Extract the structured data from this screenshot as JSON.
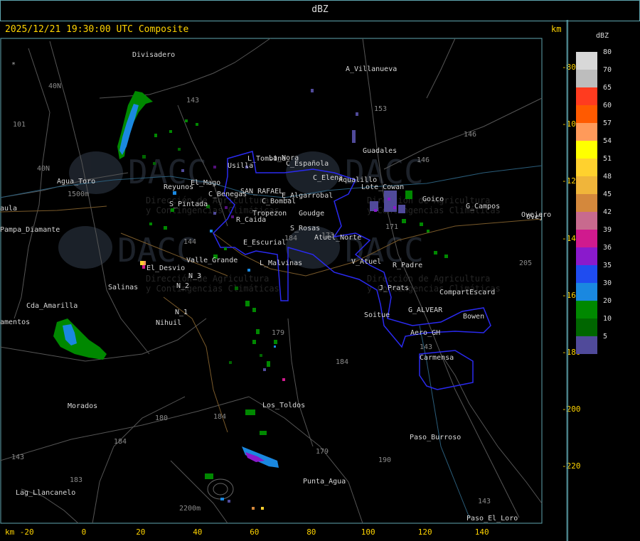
{
  "window": {
    "title": "dBZ"
  },
  "header": {
    "timestamp_label": "2025/12/21 19:30:00 UTC Composite",
    "km_unit": "km"
  },
  "axes": {
    "unit": "km",
    "y_ticks": [
      "-80",
      "-100",
      "-120",
      "-140",
      "-160",
      "-180",
      "-200",
      "-220"
    ],
    "x_ticks": [
      "-20",
      "0",
      "20",
      "40",
      "60",
      "80",
      "100",
      "120",
      "140"
    ]
  },
  "legend": {
    "title": "dBZ",
    "entries": [
      {
        "label": "80",
        "color": "#d8d8d8"
      },
      {
        "label": "70",
        "color": "#bdbdbd"
      },
      {
        "label": "65",
        "color": "#ff3b1f"
      },
      {
        "label": "60",
        "color": "#ff5a00"
      },
      {
        "label": "57",
        "color": "#ff9a5a"
      },
      {
        "label": "54",
        "color": "#ffff00"
      },
      {
        "label": "51",
        "color": "#ffd12e"
      },
      {
        "label": "48",
        "color": "#f0b53a"
      },
      {
        "label": "45",
        "color": "#d4883c"
      },
      {
        "label": "42",
        "color": "#c86a8e"
      },
      {
        "label": "39",
        "color": "#d01a8e"
      },
      {
        "label": "36",
        "color": "#8a1acc"
      },
      {
        "label": "35",
        "color": "#1f4cf0"
      },
      {
        "label": "30",
        "color": "#1a88e0"
      },
      {
        "label": "20",
        "color": "#008800"
      },
      {
        "label": "10",
        "color": "#006600"
      },
      {
        "label": "5",
        "color": "#504a9a"
      }
    ]
  },
  "watermark": {
    "brand": "DACC",
    "line1": "Dirección de Agricultura",
    "line2": "y Contingencias Climáticas"
  },
  "places": [
    {
      "name": "Divisadero"
    },
    {
      "name": "A_Villanueva"
    },
    {
      "name": "L_Tombina"
    },
    {
      "name": "Usilla"
    },
    {
      "name": "La_Nora"
    },
    {
      "name": "C_Española"
    },
    {
      "name": "C_Elena"
    },
    {
      "name": "Guadales"
    },
    {
      "name": "Aqualillo"
    },
    {
      "name": "Lote_Cowan"
    },
    {
      "name": "Goico"
    },
    {
      "name": "G_Campos"
    },
    {
      "name": "Ovejero"
    },
    {
      "name": "Agua_Toro"
    },
    {
      "name": "Reyunos"
    },
    {
      "name": "El_Mago"
    },
    {
      "name": "C_Benegas"
    },
    {
      "name": "SAN_RAFAEL"
    },
    {
      "name": "E_Algarrobal"
    },
    {
      "name": "C_Bombal"
    },
    {
      "name": "S_Pintada"
    },
    {
      "name": "Tropezon"
    },
    {
      "name": "Goudge"
    },
    {
      "name": "R_Caida"
    },
    {
      "name": "S_Rosas"
    },
    {
      "name": "Atuel_Norte"
    },
    {
      "name": "Pampa_Diamante"
    },
    {
      "name": "E_Escurial"
    },
    {
      "name": "V_Atuel"
    },
    {
      "name": "R_Padre"
    },
    {
      "name": "El_Desvio"
    },
    {
      "name": "Valle_Grande"
    },
    {
      "name": "L_Malvinas"
    },
    {
      "name": "Salinas"
    },
    {
      "name": "N_2"
    },
    {
      "name": "N_3"
    },
    {
      "name": "J_Prats"
    },
    {
      "name": "CompartEscard"
    },
    {
      "name": "Cda_Amarilla"
    },
    {
      "name": "N_1"
    },
    {
      "name": "G_ALVEAR"
    },
    {
      "name": "Nihuil"
    },
    {
      "name": "Soitue"
    },
    {
      "name": "Bowen"
    },
    {
      "name": "Aero_GH"
    },
    {
      "name": "Carmensa"
    },
    {
      "name": "Morados"
    },
    {
      "name": "Los_Toldos"
    },
    {
      "name": "Paso_Burroso"
    },
    {
      "name": "Lag_Llancanelo"
    },
    {
      "name": "Punta_Agua"
    },
    {
      "name": "Paso_El_Loro"
    }
  ],
  "partial_places": [
    {
      "name": "aula"
    },
    {
      "name": "amentos"
    },
    {
      "name": "Ovej"
    }
  ],
  "route_labels": [
    {
      "name": "40N"
    },
    {
      "name": "40N"
    },
    {
      "name": "101"
    },
    {
      "name": "143"
    },
    {
      "name": "153"
    },
    {
      "name": "146"
    },
    {
      "name": "146"
    },
    {
      "name": "144"
    },
    {
      "name": "173"
    },
    {
      "name": "171"
    },
    {
      "name": "179"
    },
    {
      "name": "184"
    },
    {
      "name": "180"
    },
    {
      "name": "184"
    },
    {
      "name": "179"
    },
    {
      "name": "190"
    },
    {
      "name": "183"
    },
    {
      "name": "143"
    },
    {
      "name": "205"
    },
    {
      "name": "184"
    },
    {
      "name": "143"
    },
    {
      "name": "184"
    },
    {
      "name": "143"
    }
  ],
  "elevation_labels": [
    {
      "name": "1500m"
    },
    {
      "name": "2200m"
    }
  ]
}
